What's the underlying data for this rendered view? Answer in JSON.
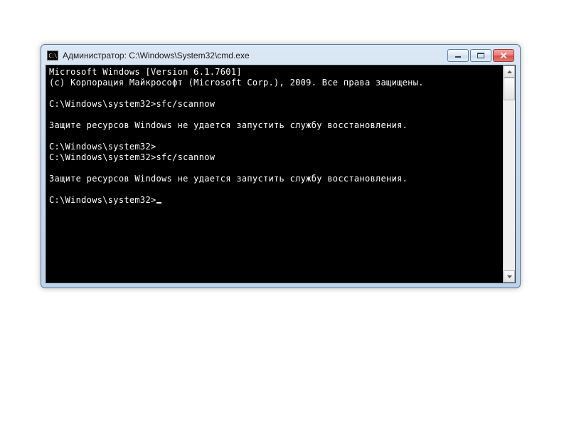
{
  "window": {
    "title": "Администратор: C:\\Windows\\System32\\cmd.exe"
  },
  "console": {
    "lines": [
      "Microsoft Windows [Version 6.1.7601]",
      "(c) Корпорация Майкрософт (Microsoft Corp.), 2009. Все права защищены.",
      "",
      "C:\\Windows\\system32>sfc/scannow",
      "",
      "Защите ресурсов Windows не удается запустить службу восстановления.",
      "",
      "C:\\Windows\\system32>",
      "C:\\Windows\\system32>sfc/scannow",
      "",
      "Защите ресурсов Windows не удается запустить службу восстановления.",
      "",
      "C:\\Windows\\system32>"
    ]
  },
  "icons": {
    "cmd_prompt_glyph": "C:\\"
  }
}
